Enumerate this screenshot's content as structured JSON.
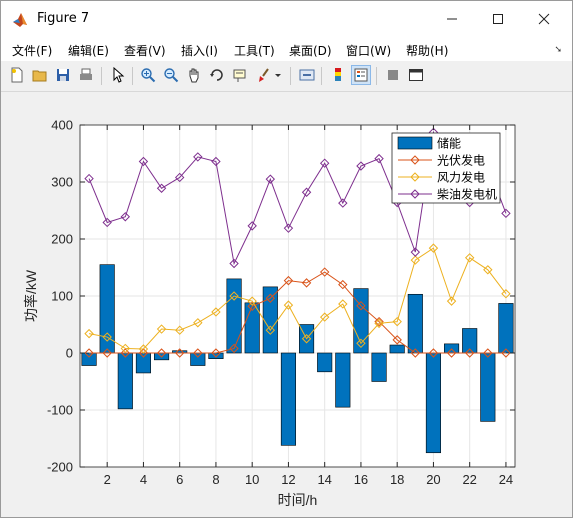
{
  "window": {
    "title": "Figure 7"
  },
  "menu": [
    "文件(F)",
    "编辑(E)",
    "查看(V)",
    "插入(I)",
    "工具(T)",
    "桌面(D)",
    "窗口(W)",
    "帮助(H)"
  ],
  "toolbar": {
    "icons": [
      "new-figure-icon",
      "open-icon",
      "save-icon",
      "print-icon",
      "pointer-icon",
      "zoom-in-icon",
      "zoom-out-icon",
      "pan-icon",
      "rotate-icon",
      "data-cursor-icon",
      "brush-icon",
      "link-icon",
      "colorbar-icon",
      "legend-icon",
      "hide-tools-icon",
      "dock-icon"
    ]
  },
  "colors": {
    "storage": "#0072bd",
    "pv": "#d95319",
    "wind": "#edb120",
    "diesel": "#7e2f8e",
    "axis_bg": "#ffffff"
  },
  "chart_data": {
    "type": "bar+line",
    "title": "",
    "xlabel": "时间/h",
    "ylabel": "功率/kW",
    "xlim": [
      0.5,
      24.5
    ],
    "ylim": [
      -200,
      400
    ],
    "xticks": [
      2,
      4,
      6,
      8,
      10,
      12,
      14,
      16,
      18,
      20,
      22,
      24
    ],
    "yticks": [
      -200,
      -100,
      0,
      100,
      200,
      300,
      400
    ],
    "grid": true,
    "legend_position": "top-right",
    "x": [
      1,
      2,
      3,
      4,
      5,
      6,
      7,
      8,
      9,
      10,
      11,
      12,
      13,
      14,
      15,
      16,
      17,
      18,
      19,
      20,
      21,
      22,
      23,
      24
    ],
    "series": [
      {
        "name": "储能",
        "kind": "bar",
        "values": [
          -22,
          155,
          -98,
          -35,
          -12,
          4,
          -22,
          -10,
          130,
          88,
          116,
          -162,
          50,
          -33,
          -95,
          113,
          -50,
          14,
          103,
          -175,
          16,
          43,
          -120,
          87
        ]
      },
      {
        "name": "光伏发电",
        "kind": "line",
        "marker": "diamond",
        "values": [
          0,
          0,
          0,
          0,
          0,
          0,
          0,
          0,
          8,
          82,
          96,
          127,
          123,
          142,
          120,
          83,
          55,
          23,
          0,
          0,
          0,
          0,
          0,
          0
        ]
      },
      {
        "name": "风力发电",
        "kind": "line",
        "marker": "diamond",
        "values": [
          34,
          28,
          8,
          7,
          42,
          40,
          53,
          72,
          100,
          91,
          40,
          84,
          25,
          63,
          86,
          17,
          52,
          55,
          163,
          184,
          91,
          167,
          146,
          104
        ]
      },
      {
        "name": "柴油发电机",
        "kind": "line",
        "marker": "diamond",
        "values": [
          306,
          229,
          239,
          336,
          289,
          308,
          344,
          336,
          157,
          223,
          305,
          219,
          282,
          333,
          263,
          328,
          341,
          264,
          177,
          387,
          304,
          264,
          329,
          245
        ]
      }
    ]
  }
}
